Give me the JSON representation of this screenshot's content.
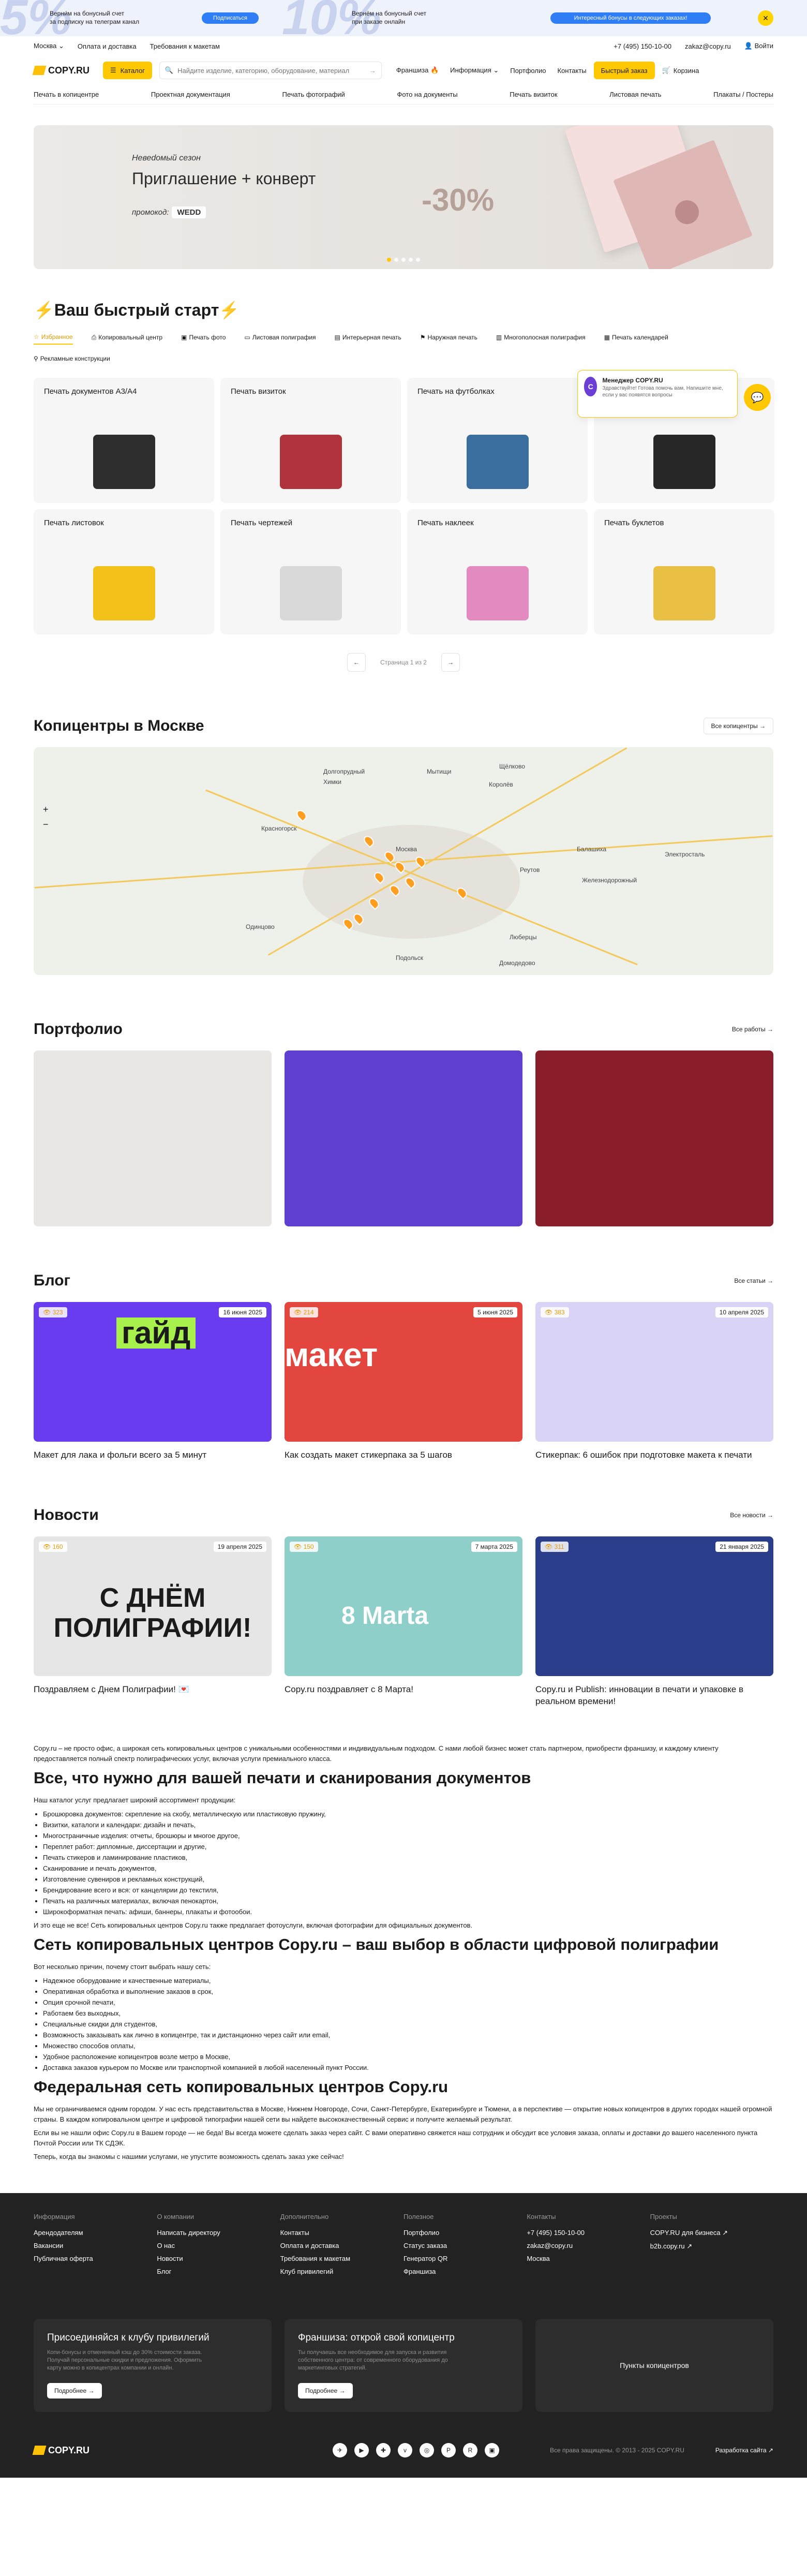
{
  "promo": {
    "left_text_1": "Верни́м на бонусный счет",
    "left_text_2": "за подписку на телеграм канал",
    "left_btn": "Подписаться",
    "mid_text_1": "Вернём на бонусный счет",
    "mid_text_2": "при заказе онлайн",
    "right_btn": "Интересный бонусы в следующих заказах!",
    "big5": "5%",
    "big10": "10%"
  },
  "topbar": {
    "city": "Москва",
    "links": [
      "Оплата и доставка",
      "Требования к макетам"
    ],
    "phone": "+7 (495) 150-10-00",
    "email": "zakaz@copy.ru",
    "login": "Войти"
  },
  "header": {
    "logo": "COPY.RU",
    "catalog": "Каталог",
    "search_placeholder": "Найдите изделие, категорию, оборудование, материал",
    "nav": [
      "Франшиза",
      "Информация",
      "Портфолио",
      "Контакты"
    ],
    "quick_order": "Быстрый заказ",
    "cart": "Корзина"
  },
  "subnav": [
    "Печать в копицентре",
    "Проектная документация",
    "Печать фотографий",
    "Фото на документы",
    "Печать визиток",
    "Листовая печать",
    "Плакаты / Постеры"
  ],
  "hero": {
    "kick": "Невеdомый сезон",
    "title": "Приглашение + конверт",
    "promo_label": "промокод:",
    "promo_code": "WEDD",
    "discount": "-30%"
  },
  "quickstart": {
    "title": "⚡Ваш быстрый старт⚡",
    "filters": [
      "Избранное",
      "Копировальный центр",
      "Печать фото",
      "Листовая полиграфия",
      "Интерьерная печать",
      "Наружная печать",
      "Многополосная полиграфия",
      "Печать календарей",
      "Рекламные конструкции"
    ],
    "products": [
      {
        "name": "Печать документов А3/А4",
        "color": "#2d2d2d"
      },
      {
        "name": "Печать визиток",
        "color": "#b0323a"
      },
      {
        "name": "Печать на футболках",
        "color": "#3a6e9e"
      },
      {
        "name": "Печать стикерпаков",
        "color": "#272727"
      },
      {
        "name": "Печать листовок",
        "color": "#f2c21b"
      },
      {
        "name": "Печать чертежей",
        "color": "#ececec"
      },
      {
        "name": "Печать наклеек",
        "color": "#e38ac0"
      },
      {
        "name": "Печать буклетов",
        "color": "#e9c043"
      }
    ],
    "pager": "Страница 1 из 2"
  },
  "manager": {
    "name": "Менеджер COPY.RU",
    "text": "Здравствуйте! Готова помочь вам. Напишите мне, если у вас появятся вопросы",
    "avatar": "C"
  },
  "copycenters": {
    "title": "Копицентры в Москве",
    "all": "Все копицентры",
    "labels": [
      "Химки",
      "Мытищи",
      "Щёлково",
      "Красногорск",
      "Москва",
      "Реутов",
      "Балашиха",
      "Железнодорожный",
      "Одинцово",
      "Люберцы",
      "Подольск",
      "Домодедово",
      "Долгопрудный",
      "Королёв",
      "Электросталь"
    ]
  },
  "portfolio": {
    "title": "Портфолио",
    "all": "Все работы",
    "items": [
      {
        "color": "#e9e7e3"
      },
      {
        "color": "#5e3fd0"
      },
      {
        "color": "#8a1f2b"
      }
    ]
  },
  "blog": {
    "title": "Блог",
    "all": "Все статьи",
    "items": [
      {
        "title": "Макет для лака и фольги всего за 5 минут",
        "date": "16 июня 2025",
        "views": "323",
        "color": "#6a3cf0",
        "big": "гайд"
      },
      {
        "title": "Как создать макет стикерпака за 5 шагов",
        "date": "5 июня 2025",
        "views": "214",
        "color": "#e2463f",
        "big": "макет"
      },
      {
        "title": "Стикерпак: 6 ошибок при подготовке макета к печати",
        "date": "10 апреля 2025",
        "views": "383",
        "color": "#d9d3f5",
        "big": ""
      }
    ]
  },
  "news": {
    "title": "Новости",
    "all": "Все новости",
    "items": [
      {
        "title": "Поздравляем с Днем Полиграфии! 💌",
        "date": "19 апреля 2025",
        "views": "160",
        "color": "#e6e6e6",
        "big": "С ДНЁМ ПОЛИГРАФИИ!"
      },
      {
        "title": "Copy.ru поздравляет с 8 Марта!",
        "date": "7 марта 2025",
        "views": "150",
        "color": "#8ed0c9",
        "big": "8 Marta"
      },
      {
        "title": "Copy.ru и Publish: инновации в печати и упаковке в реальном времени!",
        "date": "21 января 2025",
        "views": "311",
        "color": "#2b3e8c",
        "big": ""
      }
    ]
  },
  "seo": {
    "intro": "Copy.ru – не просто офис, а широкая сеть копировальных центров с уникальными особенностями и индивидуальным подходом. С нами любой бизнес может стать партнером, приобрести франшизу, и каждому клиенту предоставляется полный спектр полиграфических услуг, включая услуги премиального класса.",
    "h1": "Все, что нужно для вашей печати и сканирования документов",
    "p1": "Наш каталог услуг предлагает широкий ассортимент продукции:",
    "list1": [
      "Брошюровка документов: скрепление на скобу, металлическую или пластиковую пружину,",
      "Визитки, каталоги и календари: дизайн и печать,",
      "Многостраничные изделия: отчеты, брошюры и многое другое,",
      "Переплет работ: дипломные, диссертации и другие,",
      "Печать стикеров и ламинирование пластиков,",
      "Сканирование и печать документов,",
      "Изготовление сувениров и рекламных конструкций,",
      "Брендирование всего и вся: от канцелярии до текстиля,",
      "Печать на различных материалах, включая пенокартон,",
      "Широкоформатная печать: афиши, баннеры, плакаты и фотообои."
    ],
    "p2": "И это еще не все! Сеть копировальных центров Copy.ru также предлагает фотоуслуги, включая фотографии для официальных документов.",
    "h2": "Сеть копировальных центров Copy.ru – ваш выбор в области цифровой полиграфии",
    "p3": "Вот несколько причин, почему стоит выбрать нашу сеть:",
    "list2": [
      "Надежное оборудование и качественные материалы,",
      "Оперативная обработка и выполнение заказов в срок,",
      "Опция срочной печати,",
      "Работаем без выходных,",
      "Специальные скидки для студентов,",
      "Возможность заказывать как лично в копицентре, так и дистанционно через сайт или email,",
      "Множество способов оплаты,",
      "Удобное расположение копицентров возле метро в Москве,",
      "Доставка заказов курьером по Москве или транспортной компанией в любой населенный пункт России."
    ],
    "h3": "Федеральная сеть копировальных центров Copy.ru",
    "p4": "Мы не ограничиваемся одним городом. У нас есть представительства в Москве, Нижнем Новгороде, Сочи, Санкт-Петербурге, Екатеринбурге и Тюмени, а в перспективе — открытие новых копицентров в других городах нашей огромной страны. В каждом копировальном центре и цифровой типографии нашей сети вы найдете высококачественный сервис и получите желаемый результат.",
    "p5": "Если вы не нашли офис Copy.ru в Вашем городе — не беда! Вы всегда можете сделать заказ через сайт. С вами оперативно свяжется наш сотрудник и обсудит все условия заказа, оплаты и доставки до вашего населенного пункта Почтой России или ТК СДЭК.",
    "p6": "Теперь, когда вы знакомы с нашими услугами, не упустите возможность сделать заказ уже сейчас!"
  },
  "footer": {
    "cols": [
      {
        "title": "Информация",
        "items": [
          "Арендодателям",
          "Вакансии",
          "Публичная оферта"
        ]
      },
      {
        "title": "О компании",
        "items": [
          "Написать директору",
          "О нас",
          "Новости",
          "Блог"
        ]
      },
      {
        "title": "Дополнительно",
        "items": [
          "Контакты",
          "Оплата и доставка",
          "Требования к макетам",
          "Клуб привилегий"
        ]
      },
      {
        "title": "Полезное",
        "items": [
          "Портфолио",
          "Статус заказа",
          "Генератор QR",
          "Франшиза"
        ]
      },
      {
        "title": "Контакты",
        "items": [
          "+7 (495) 150-10-00",
          "zakaz@copy.ru",
          "Москва"
        ]
      },
      {
        "title": "Проекты",
        "items": [
          "COPY.RU для бизнеса ↗",
          "b2b.copy.ru ↗"
        ]
      }
    ],
    "card1": {
      "title": "Присоединяйся к клубу привилегий",
      "text": "Копи-бонусы и отмененный кэш до 30% стоимости заказа. Получай персональные скидки и предложения. Оформить карту можно в копицентрах компании и онлайн.",
      "btn": "Подробнее →"
    },
    "card2": {
      "title": "Франшиза: открой свой копицентр",
      "text": "Ты получаешь все необходимое для запуска и развития собственного центра: от современного оборудования до маркетинговых стратегий.",
      "btn": "Подробнее →"
    },
    "card3": {
      "title": "Пункты копицентров"
    },
    "copyright": "Все права защищены. © 2013 - 2025 COPY.RU",
    "socials": [
      "tg",
      "yt",
      "vk",
      "ok",
      "in",
      "dz",
      "rt",
      "vc"
    ],
    "dev": "Разработка сайта ↗"
  }
}
